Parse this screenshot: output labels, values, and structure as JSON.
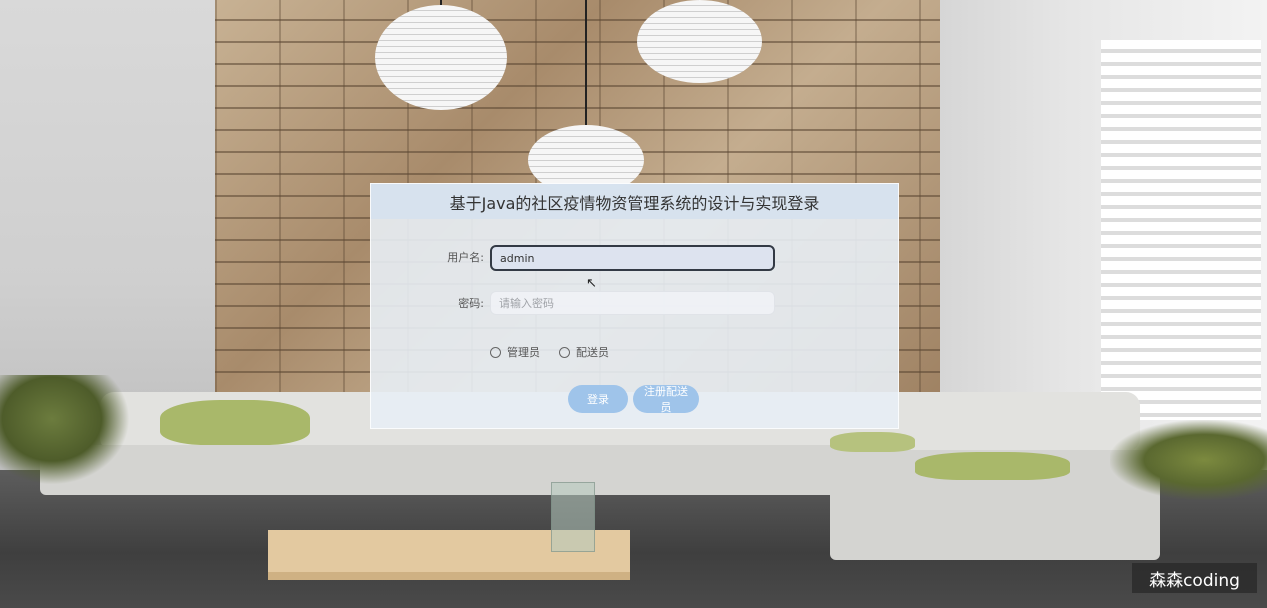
{
  "login": {
    "title": "基于Java的社区疫情物资管理系统的设计与实现登录",
    "username_label": "用户名:",
    "username_value": "admin",
    "password_label": "密码:",
    "password_placeholder": "请输入密码",
    "roles": [
      "管理员",
      "配送员"
    ],
    "login_button": "登录",
    "register_button": "注册配送员"
  },
  "watermark": "森森coding",
  "colors": {
    "button": "#9fc4ea",
    "panel": "#e8eef5",
    "title_bar": "#d6e2ee"
  }
}
